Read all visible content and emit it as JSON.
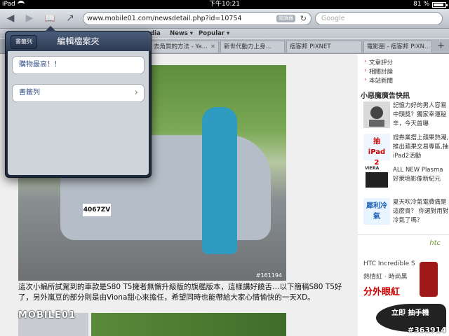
{
  "status_bar": {
    "device": "iPad",
    "time": "下午10:21",
    "battery": "81 %"
  },
  "toolbar": {
    "back": "◀",
    "forward": "▶",
    "bookmarks": "📖",
    "share": "↗",
    "url": "www.mobile01.com/newsdetail.php?id=10754",
    "url_badge": "閱讀器",
    "reload": "↻",
    "search_placeholder": "Google"
  },
  "bookmarks_bar": {
    "items": [
      "dia",
      "News ▾",
      "Popular ▾"
    ]
  },
  "tabs": {
    "items": [
      "去角質的方法 - Ya...",
      "新世代動力上身...",
      "痞客邦 PIXNET",
      "電影圈 - 痞客邦 PIXN..."
    ],
    "close": "✕",
    "add": "+"
  },
  "popover": {
    "back_label": "書籤列",
    "title": "編輯檔案夾",
    "rows": [
      {
        "label": "購物最高！！"
      },
      {
        "label": "書籤列",
        "chevron": "›"
      }
    ]
  },
  "article": {
    "plate": "4067ZV",
    "photo_watermark": "#161194",
    "caption": "這次小編所試駕到的車款是S80 T5擁者無懈升級版的旗艦版本，這樣講好饒舌…以下簡稱S80 T5好了，另外嵐豆的部分則是由Viona甜心來擔任，希望同時也能帶給大家心情愉快的一天XD。",
    "logo": "MOBILE01"
  },
  "sidebar": {
    "links": [
      "文章評分",
      "相關討論",
      "本站新聞"
    ],
    "section_title": "小惡魔廣告快訊",
    "ads": [
      {
        "text": "記憶力好的男人容易中頭獎？獨家幸運秘辛，今天首曝"
      },
      {
        "thumb_text": "抽 iPad 2",
        "text": "證券業搭上蘋果熱潮,推出蘋果交易專區,抽iPad2活動"
      },
      {
        "thumb_text": "VIERA",
        "text": "ALL NEW Plasma 好萊塢影像新紀元"
      },
      {
        "thumb_text": "犀利冷氣",
        "text": "夏天吹冷氣電費痛是這麼貴？ 你選對用對冷氣了嗎？"
      }
    ],
    "htc": {
      "brand": "htc",
      "line1": "HTC Incredible S",
      "line2": "熱情紅 · 時尚黑",
      "line3": "分外眼紅",
      "fish_text": "立即 抽手機"
    }
  },
  "screenshot_watermark": "#363914",
  "colors": {
    "popover_header": "#2c3a52",
    "row_text": "#385487",
    "accent_red": "#c00000"
  }
}
